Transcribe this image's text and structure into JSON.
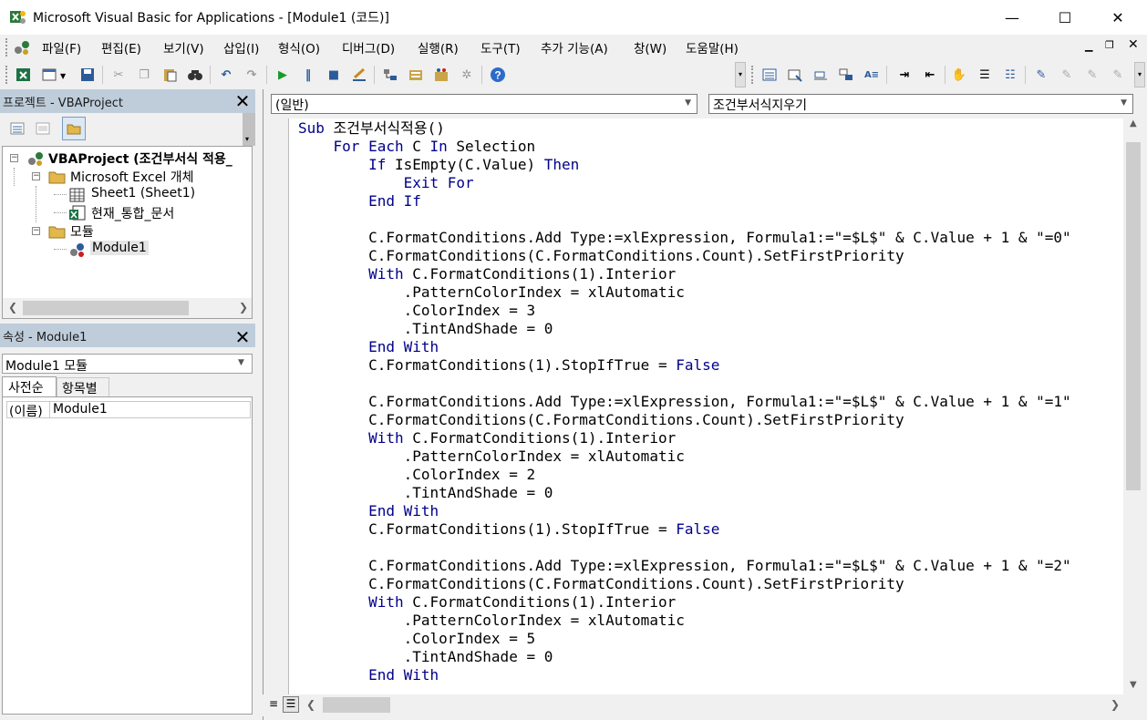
{
  "window": {
    "title": "Microsoft Visual Basic for Applications - [Module1 (코드)]",
    "minimize": "—",
    "maximize": "☐",
    "close": "✕"
  },
  "menu": [
    "파일(F)",
    "편집(E)",
    "보기(V)",
    "삽입(I)",
    "형식(O)",
    "디버그(D)",
    "실행(R)",
    "도구(T)",
    "추가 기능(A)",
    "창(W)",
    "도움말(H)"
  ],
  "project_pane": {
    "title": "프로젝트 - VBAProject",
    "tree": [
      {
        "label": "VBAProject (조건부서식 적용_",
        "level": 0,
        "expander": "−",
        "icon": "vba-project-icon",
        "bold": true
      },
      {
        "label": "Microsoft Excel 개체",
        "level": 1,
        "expander": "−",
        "icon": "folder-icon"
      },
      {
        "label": "Sheet1 (Sheet1)",
        "level": 2,
        "expander": "",
        "icon": "sheet-icon"
      },
      {
        "label": "현재_통합_문서",
        "level": 2,
        "expander": "",
        "icon": "workbook-icon"
      },
      {
        "label": "모듈",
        "level": 1,
        "expander": "−",
        "icon": "folder-icon"
      },
      {
        "label": "Module1",
        "level": 2,
        "expander": "",
        "icon": "module-icon",
        "selected": true
      }
    ]
  },
  "properties_pane": {
    "title": "속성 - Module1",
    "object_select": "Module1 모듈",
    "tabs": [
      "사전순",
      "항목별"
    ],
    "rows": [
      {
        "name": "(이름)",
        "value": "Module1"
      }
    ]
  },
  "code_window": {
    "object_combo": "(일반)",
    "proc_combo": "조건부서식지우기",
    "lines": [
      [
        {
          "t": "Sub ",
          "k": true
        },
        {
          "t": "조건부서식적용()"
        }
      ],
      [
        {
          "t": "    "
        },
        {
          "t": "For Each",
          "k": true
        },
        {
          "t": " C "
        },
        {
          "t": "In",
          "k": true
        },
        {
          "t": " Selection"
        }
      ],
      [
        {
          "t": "        "
        },
        {
          "t": "If",
          "k": true
        },
        {
          "t": " IsEmpty(C.Value) "
        },
        {
          "t": "Then",
          "k": true
        }
      ],
      [
        {
          "t": "            "
        },
        {
          "t": "Exit For",
          "k": true
        }
      ],
      [
        {
          "t": "        "
        },
        {
          "t": "End If",
          "k": true
        }
      ],
      [
        {
          "t": ""
        }
      ],
      [
        {
          "t": "        C.FormatConditions.Add Type:=xlExpression, Formula1:=\"=$L$\" & C.Value + 1 & \"=0\""
        }
      ],
      [
        {
          "t": "        C.FormatConditions(C.FormatConditions.Count).SetFirstPriority"
        }
      ],
      [
        {
          "t": "        "
        },
        {
          "t": "With",
          "k": true
        },
        {
          "t": " C.FormatConditions(1).Interior"
        }
      ],
      [
        {
          "t": "            .PatternColorIndex = xlAutomatic"
        }
      ],
      [
        {
          "t": "            .ColorIndex = 3"
        }
      ],
      [
        {
          "t": "            .TintAndShade = 0"
        }
      ],
      [
        {
          "t": "        "
        },
        {
          "t": "End With",
          "k": true
        }
      ],
      [
        {
          "t": "        C.FormatConditions(1).StopIfTrue = "
        },
        {
          "t": "False",
          "k": true
        }
      ],
      [
        {
          "t": ""
        }
      ],
      [
        {
          "t": "        C.FormatConditions.Add Type:=xlExpression, Formula1:=\"=$L$\" & C.Value + 1 & \"=1\""
        }
      ],
      [
        {
          "t": "        C.FormatConditions(C.FormatConditions.Count).SetFirstPriority"
        }
      ],
      [
        {
          "t": "        "
        },
        {
          "t": "With",
          "k": true
        },
        {
          "t": " C.FormatConditions(1).Interior"
        }
      ],
      [
        {
          "t": "            .PatternColorIndex = xlAutomatic"
        }
      ],
      [
        {
          "t": "            .ColorIndex = 2"
        }
      ],
      [
        {
          "t": "            .TintAndShade = 0"
        }
      ],
      [
        {
          "t": "        "
        },
        {
          "t": "End With",
          "k": true
        }
      ],
      [
        {
          "t": "        C.FormatConditions(1).StopIfTrue = "
        },
        {
          "t": "False",
          "k": true
        }
      ],
      [
        {
          "t": ""
        }
      ],
      [
        {
          "t": "        C.FormatConditions.Add Type:=xlExpression, Formula1:=\"=$L$\" & C.Value + 1 & \"=2\""
        }
      ],
      [
        {
          "t": "        C.FormatConditions(C.FormatConditions.Count).SetFirstPriority"
        }
      ],
      [
        {
          "t": "        "
        },
        {
          "t": "With",
          "k": true
        },
        {
          "t": " C.FormatConditions(1).Interior"
        }
      ],
      [
        {
          "t": "            .PatternColorIndex = xlAutomatic"
        }
      ],
      [
        {
          "t": "            .ColorIndex = 5"
        }
      ],
      [
        {
          "t": "            .TintAndShade = 0"
        }
      ],
      [
        {
          "t": "        "
        },
        {
          "t": "End With",
          "k": true
        }
      ]
    ]
  },
  "colors": {
    "keyword": "#00008b",
    "pane_header": "#bfcddb",
    "selection": "#e5e5e5"
  }
}
